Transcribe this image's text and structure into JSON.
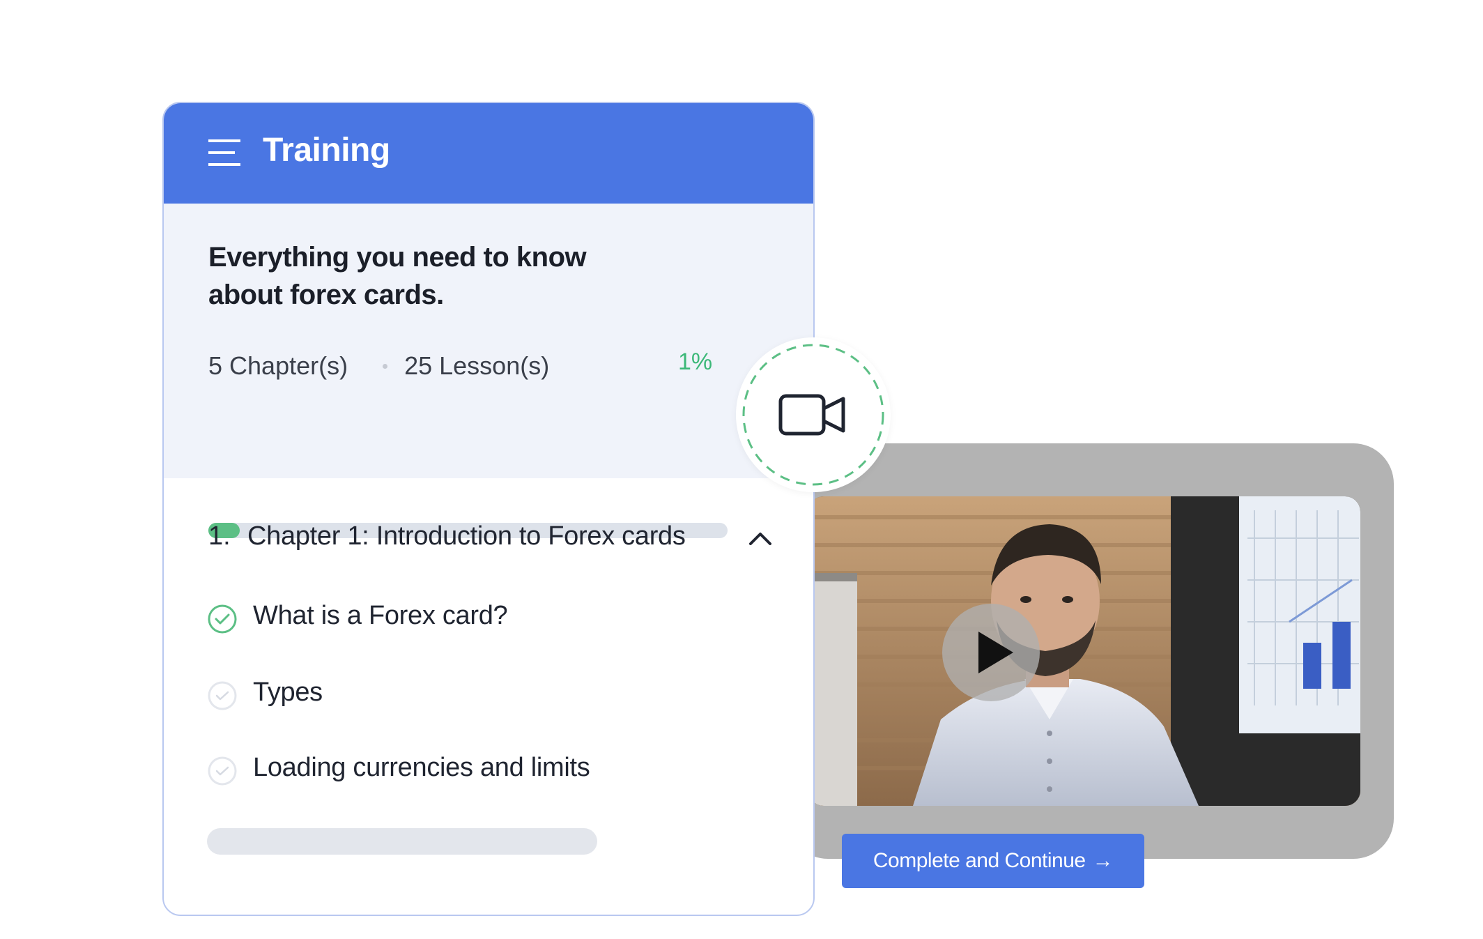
{
  "header": {
    "title": "Training",
    "menu_icon": "hamburger-menu-icon",
    "color": "#4a76e3"
  },
  "course": {
    "title_line1": "Everything you need to know",
    "title_line2": "about forex cards.",
    "chapters": "5 Chapter(s)",
    "lessons": "25 Lesson(s)",
    "progress_label": "1%",
    "progress_value": 0.06,
    "progress_color": "#5cbf85"
  },
  "chapter": {
    "number": "1.",
    "title": "Chapter 1: Introduction to Forex cards",
    "expanded_icon": "chevron-up-icon"
  },
  "lessons": [
    {
      "label": "What is a Forex card?",
      "status": "completed",
      "icon": "check-circle-icon"
    },
    {
      "label": "Types",
      "status": "pending",
      "icon": "check-circle-icon"
    },
    {
      "label": "Loading currencies and limits",
      "status": "pending",
      "icon": "check-circle-icon"
    }
  ],
  "video": {
    "badge_icon": "video-camera-icon",
    "play_icon": "play-icon",
    "cta_label": "Complete and Continue",
    "cta_arrow": "→",
    "cta_color": "#4a76e3"
  },
  "colors": {
    "accent": "#4a76e3",
    "success": "#3cb878",
    "dashed_ring": "#5cbf85"
  }
}
